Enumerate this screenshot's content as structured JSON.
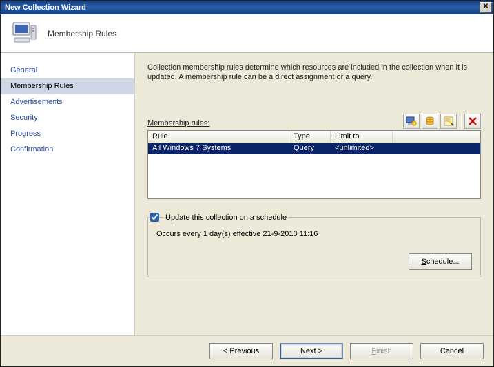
{
  "title": "New Collection Wizard",
  "header": {
    "heading": "Membership Rules"
  },
  "sidebar": {
    "items": [
      {
        "label": "General"
      },
      {
        "label": "Membership Rules"
      },
      {
        "label": "Advertisements"
      },
      {
        "label": "Security"
      },
      {
        "label": "Progress"
      },
      {
        "label": "Confirmation"
      }
    ],
    "active_index": 1
  },
  "content": {
    "description": "Collection membership rules determine which resources are included in the collection when it is updated. A membership rule can be a direct assignment or a query.",
    "rules_label": "Membership rules:",
    "columns": {
      "rule": "Rule",
      "type": "Type",
      "limit": "Limit to"
    },
    "rows": [
      {
        "rule": "All Windows 7 Systems",
        "type": "Query",
        "limit": "<unlimited>"
      }
    ],
    "toolbar_icons": {
      "new_computer": "new-computer-rule-icon",
      "new_query": "new-query-rule-icon",
      "properties": "properties-icon",
      "delete": "delete-icon"
    },
    "schedule": {
      "checkbox_label": "Update this collection on a schedule",
      "checked": true,
      "summary": "Occurs every 1 day(s) effective 21-9-2010 11:16",
      "button": "Schedule..."
    }
  },
  "footer": {
    "previous": "< Previous",
    "next": "Next >",
    "finish": "Finish",
    "cancel": "Cancel"
  }
}
